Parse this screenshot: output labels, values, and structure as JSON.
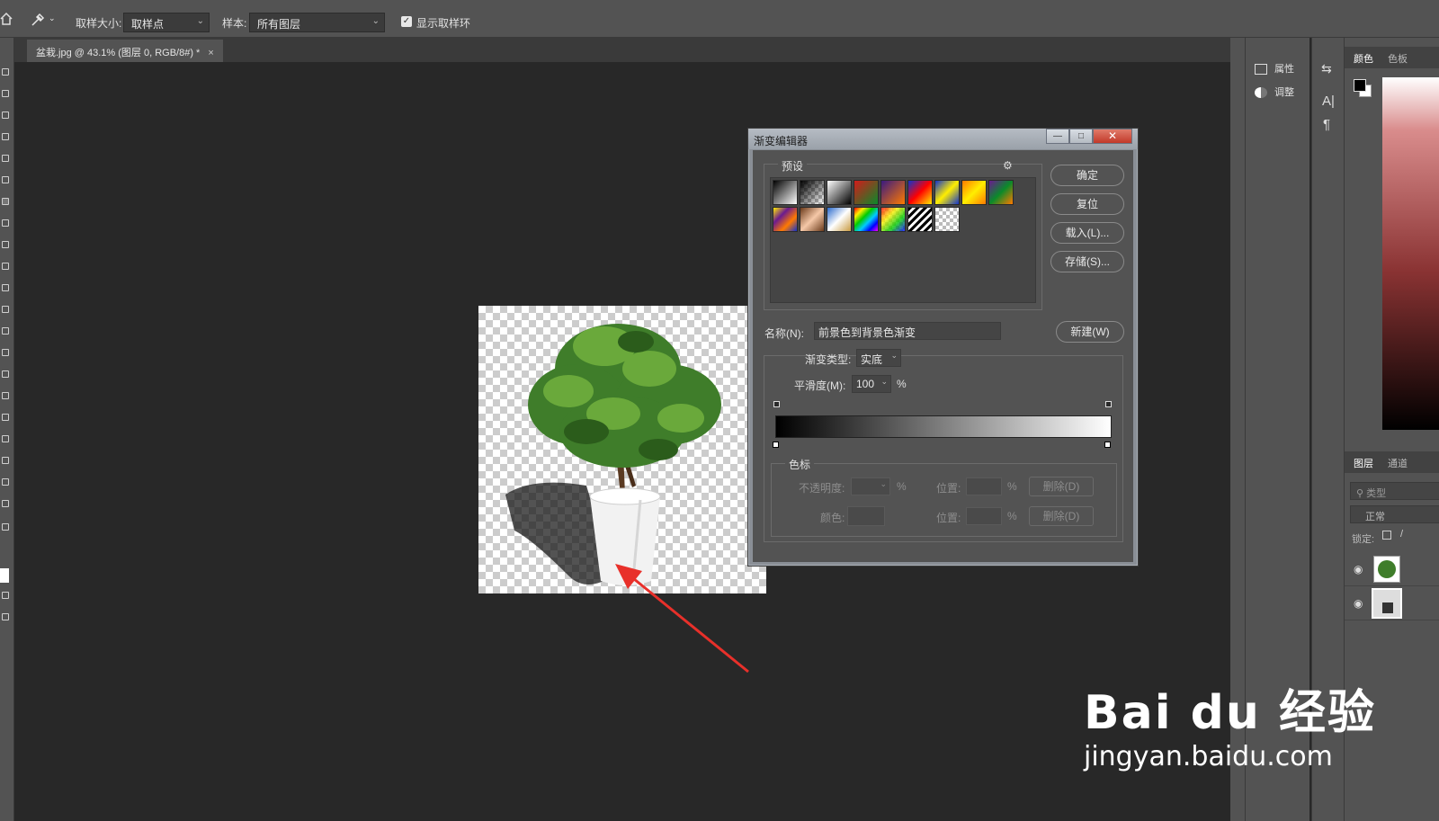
{
  "options_bar": {
    "sample_size_label": "取样大小:",
    "sample_size_value": "取样点",
    "sample_label": "样本:",
    "sample_value": "所有图层",
    "show_ring_label": "显示取样环",
    "show_ring_checked": true
  },
  "document": {
    "tab_title": "盆栽.jpg @ 43.1% (图层 0, RGB/8#) *",
    "close": "×"
  },
  "right_panels": {
    "properties": "属性",
    "adjustments": "调整",
    "color_tab": "颜色",
    "swatches_tab": "色板",
    "layers_tab": "图层",
    "channels_tab": "通道",
    "search_placeholder": "类型",
    "blend_mode": "正常",
    "lock_label": "锁定:"
  },
  "gradient_editor": {
    "title": "渐变编辑器",
    "win_minimize": "—",
    "win_maximize": "□",
    "win_close": "✕",
    "presets_label": "预设",
    "buttons": {
      "ok": "确定",
      "reset": "复位",
      "load": "载入(L)...",
      "save": "存储(S)...",
      "new": "新建(W)"
    },
    "name_label": "名称(N):",
    "name_value": "前景色到背景色渐变",
    "type_label": "渐变类型:",
    "type_value": "实底",
    "smoothness_label": "平滑度(M):",
    "smoothness_value": "100",
    "percent": "%",
    "stops_label": "色标",
    "opacity_label": "不透明度:",
    "location_label": "位置:",
    "delete_label": "删除(D)",
    "color_label": "颜色:",
    "presets": [
      {
        "icon": "gradient-fg-bg"
      },
      {
        "icon": "gradient-fg-transparent"
      },
      {
        "icon": "gradient-black-white"
      },
      {
        "icon": "gradient-red-green"
      },
      {
        "icon": "gradient-violet-orange"
      },
      {
        "icon": "gradient-blue-red-yellow"
      },
      {
        "icon": "gradient-blue-yellow-blue"
      },
      {
        "icon": "gradient-orange-yellow-orange"
      },
      {
        "icon": "gradient-violet-green-orange"
      },
      {
        "icon": "gradient-yellow-violet-orange-blue"
      },
      {
        "icon": "gradient-copper"
      },
      {
        "icon": "gradient-chrome"
      },
      {
        "icon": "gradient-spectrum"
      },
      {
        "icon": "gradient-transparent-rainbow"
      },
      {
        "icon": "gradient-transparent-stripes"
      },
      {
        "icon": "gradient-transparent"
      }
    ]
  },
  "watermark": {
    "brand": "Bai du 经验",
    "url": "jingyan.baidu.com"
  }
}
